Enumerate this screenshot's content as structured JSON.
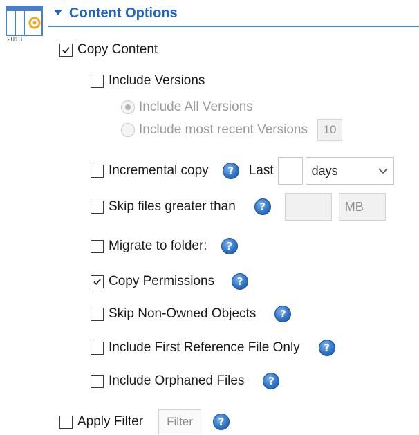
{
  "header": {
    "title": "Content Options",
    "year_label": "2013"
  },
  "copy_content": {
    "label": "Copy Content",
    "checked": true
  },
  "include_versions": {
    "label": "Include Versions",
    "checked": false
  },
  "radio_all": {
    "label": "Include All Versions",
    "selected": true
  },
  "radio_recent": {
    "label": "Include most recent Versions",
    "count": "10"
  },
  "incremental": {
    "label": "Incremental copy",
    "last_label": "Last",
    "value": "",
    "unit": "days"
  },
  "skip_large": {
    "label": "Skip files greater than",
    "value": "",
    "unit": "MB"
  },
  "migrate_folder": {
    "label": "Migrate to folder:"
  },
  "copy_permissions": {
    "label": "Copy Permissions",
    "checked": true
  },
  "skip_non_owned": {
    "label": "Skip Non-Owned Objects"
  },
  "first_reference": {
    "label": "Include First Reference File Only"
  },
  "orphaned": {
    "label": "Include Orphaned Files"
  },
  "apply_filter": {
    "label": "Apply Filter",
    "placeholder": "Filter"
  },
  "colors": {
    "accent": "#1f63c4",
    "disabled_text": "#9a9a9a"
  },
  "icons": {
    "help": "?",
    "collapse": "triangle-down-icon",
    "calendar": "calendar-2013-icon",
    "dropdown": "chevron-down-icon"
  }
}
